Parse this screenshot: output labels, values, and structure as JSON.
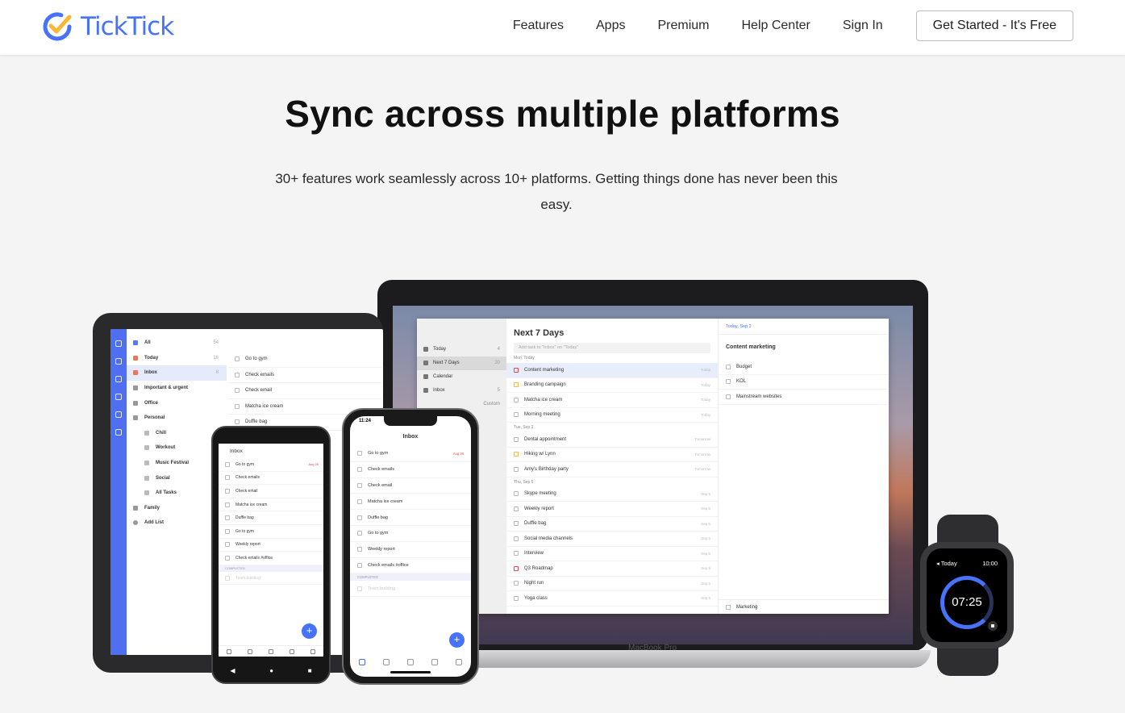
{
  "brand": {
    "name": "TickTick",
    "accent": "#4772fa"
  },
  "nav": {
    "links": [
      "Features",
      "Apps",
      "Premium",
      "Help Center",
      "Sign In"
    ],
    "cta": "Get Started - It's Free"
  },
  "hero": {
    "title": "Sync across multiple platforms",
    "subtitle": "30+ features work seamlessly across 10+ platforms. Getting things done has never been this easy."
  },
  "tablet": {
    "sidebar": [
      {
        "label": "All",
        "count": "54"
      },
      {
        "label": "Today",
        "count": "16"
      },
      {
        "label": "Inbox",
        "count": "8"
      },
      {
        "label": "Important & urgent",
        "count": ""
      },
      {
        "label": "Office",
        "count": ""
      },
      {
        "label": "Personal",
        "count": ""
      },
      {
        "label": "Chill",
        "count": ""
      },
      {
        "label": "Workout",
        "count": ""
      },
      {
        "label": "Music Festival",
        "count": ""
      },
      {
        "label": "Social",
        "count": ""
      },
      {
        "label": "All Tasks",
        "count": ""
      },
      {
        "label": "Family",
        "count": ""
      },
      {
        "label": "Add List",
        "count": ""
      }
    ],
    "tasks": [
      "Go to gym",
      "Check emails",
      "Check email",
      "Matcha ice cream",
      "Duffle bag"
    ]
  },
  "laptop": {
    "model_label": "MacBook Pro",
    "sidebar": [
      {
        "label": "Today",
        "count": "4"
      },
      {
        "label": "Next 7 Days",
        "count": "20"
      },
      {
        "label": "Calendar",
        "count": ""
      },
      {
        "label": "Inbox",
        "count": "5"
      }
    ],
    "sidebar_tabs": [
      "Custom"
    ],
    "list_title": "Next 7 Days",
    "add_placeholder": "Add task to \"Inbox\" on \"Today\"",
    "sections": [
      {
        "header": "Mon, Today",
        "tasks": [
          {
            "title": "Content marketing",
            "date": "Today"
          },
          {
            "title": "Branding campaign",
            "date": "Today"
          },
          {
            "title": "Matcha ice cream",
            "date": "Today"
          },
          {
            "title": "Morning meeting",
            "date": "Today"
          }
        ]
      },
      {
        "header": "Tue, Sep 3",
        "tasks": [
          {
            "title": "Dental appointment",
            "date": "Tomorrow"
          },
          {
            "title": "Hiking w/ Lynn",
            "date": "Tomorrow"
          },
          {
            "title": "Amy's Birthday party",
            "date": "Tomorrow"
          }
        ]
      },
      {
        "header": "Thu, Sep 5",
        "tasks": [
          {
            "title": "Skype meeting",
            "date": "Sep 5"
          },
          {
            "title": "Weekly report",
            "date": "Sep 5"
          },
          {
            "title": "Duffle bag",
            "date": "Sep 5"
          },
          {
            "title": "Social media channels",
            "date": "Sep 5"
          },
          {
            "title": "Interview",
            "date": "Sep 5"
          },
          {
            "title": "Q3 Roadmap",
            "date": "Sep 5"
          },
          {
            "title": "Night run",
            "date": "Sep 5"
          },
          {
            "title": "Yoga class",
            "date": "Sep 5"
          }
        ]
      }
    ],
    "detail": {
      "date": "Today, Sep 2",
      "title": "Content marketing",
      "items": [
        "Budget",
        "KOL",
        "Mainstream websites"
      ],
      "list": "Marketing"
    }
  },
  "android": {
    "header": "Inbox",
    "tasks": [
      {
        "title": "Go to gym",
        "date": "Aug 26"
      },
      {
        "title": "Check emails",
        "date": ""
      },
      {
        "title": "Check email",
        "date": ""
      },
      {
        "title": "Matcha ice cream",
        "date": ""
      },
      {
        "title": "Duffle bag",
        "date": ""
      },
      {
        "title": "Go to gym",
        "date": ""
      },
      {
        "title": "Weekly report",
        "date": ""
      },
      {
        "title": "Check emails #office",
        "date": ""
      }
    ],
    "completed_label": "COMPLETED",
    "completed_task": "Team building"
  },
  "iphone": {
    "status_time": "11:24",
    "header": "Inbox",
    "tasks": [
      {
        "title": "Go to gym",
        "date": "Aug 26"
      },
      {
        "title": "Check emails",
        "date": ""
      },
      {
        "title": "Check email",
        "date": ""
      },
      {
        "title": "Matcha ice cream",
        "date": ""
      },
      {
        "title": "Duffle bag",
        "date": ""
      },
      {
        "title": "Go to gym",
        "date": ""
      },
      {
        "title": "Weekly report",
        "date": ""
      },
      {
        "title": "Check emails #office",
        "date": ""
      }
    ],
    "completed_label": "COMPLETED",
    "completed_task": "Team building"
  },
  "watch": {
    "back_label": "◂ Today",
    "clock": "10:00",
    "timer": "07:25",
    "progress": 0.75
  }
}
